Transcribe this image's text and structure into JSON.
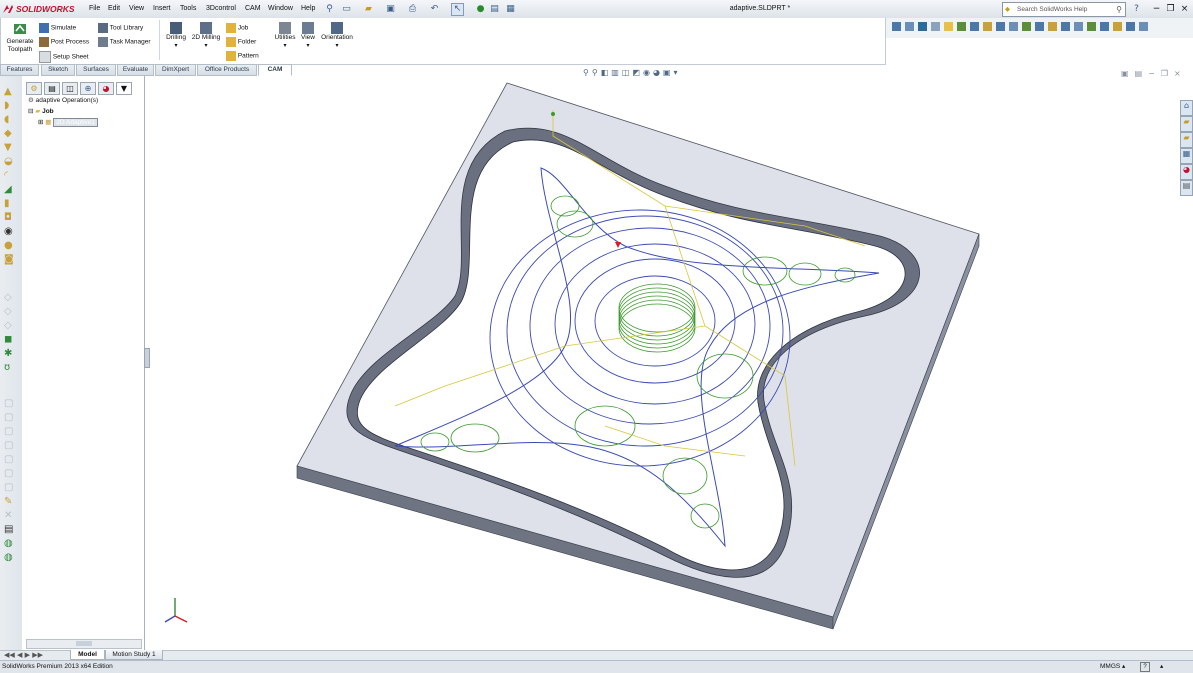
{
  "app": {
    "logo_text": "SOLIDWORKS",
    "document_title": "adaptive.SLDPRT *",
    "colors": {
      "brand_red": "#c8102e",
      "toolpath_blue": "#3a4bb5",
      "toolpath_green": "#3b9b2b",
      "toolpath_yellow": "#d9c63a"
    }
  },
  "menu": [
    "File",
    "Edit",
    "View",
    "Insert",
    "Tools",
    "3Dcontrol",
    "CAM",
    "Window",
    "Help"
  ],
  "search": {
    "placeholder": "Search SolidWorks Help"
  },
  "ribbon": {
    "generate_toolpath_line1": "Generate",
    "generate_toolpath_line2": "Toolpath",
    "simulate": "Simulate",
    "post_process": "Post Process",
    "setup_sheet": "Setup Sheet",
    "tool_library": "Tool Library",
    "task_manager": "Task Manager",
    "drilling": "Drilling",
    "milling_2d": "2D Milling",
    "job": "Job",
    "folder": "Folder",
    "pattern": "Pattern",
    "utilities": "Utilities",
    "view": "View",
    "orientation": "Orientation"
  },
  "tabs": [
    "Features",
    "Sketch",
    "Surfaces",
    "Evaluate",
    "DimXpert",
    "Office Products",
    "CAM"
  ],
  "active_tab": "CAM",
  "tree": {
    "root": "adaptive Operation(s)",
    "job": "Job",
    "selected_item": "2D Adaptive1"
  },
  "bottom_tabs": [
    "Model",
    "Motion Study 1"
  ],
  "status": {
    "edition": "SolidWorks Premium 2013 x64 Edition",
    "units": "MMGS"
  }
}
